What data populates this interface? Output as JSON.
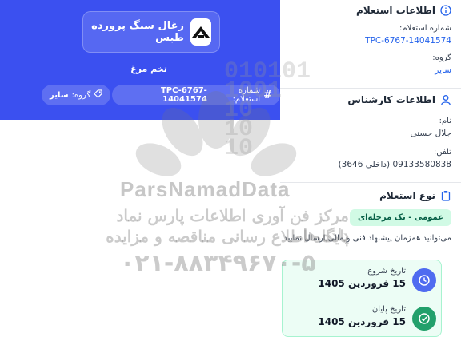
{
  "header": {
    "company_name": "زغال سنگ پرورده طبس",
    "subject": "تخم مرغ",
    "inquiry_number_label": "شماره استعلام:",
    "inquiry_number": "TPC-6767-14041574",
    "group_label": "گروه:",
    "group_value": "سایر"
  },
  "inquiry_info": {
    "title": "اطلاعات استعلام",
    "number_label": "شماره استعلام:",
    "number_value": "TPC-6767-14041574",
    "group_label": "گروه:",
    "group_value": "سایر"
  },
  "expert_info": {
    "title": "اطلاعات کارشناس",
    "name_label": "نام:",
    "name_value": "جلال حسنی",
    "phone_label": "تلفن:",
    "phone_value": "09133580838 (داخلی 3646)"
  },
  "inquiry_type": {
    "title": "نوع استعلام",
    "badge": "عمومی - تک مرحله‌ای",
    "description": "می‌توانید همزمان پیشنهاد فنی و مالی ارسال نمایید"
  },
  "dates": {
    "start_label": "تاریخ شروع",
    "start_value": "15 فروردین 1405",
    "end_label": "تاریخ پایان",
    "end_value": "15 فروردین 1405"
  },
  "watermark": {
    "digits": "010101\n1001\n10\n10\n10",
    "brand": "ParsNamadData",
    "line1": "مرکز فن آوری اطلاعات پارس نماد داده ها",
    "line2": "پایگاه اطلاع رسانی مناقصه و مزایده",
    "phone": "۰۲۱-۸۸۳۴۹۶۷۰-۵"
  },
  "colors": {
    "hero_blue": "#3b50f0",
    "link_blue": "#2563eb",
    "green_bg": "#ecfdf5",
    "clock_circle": "#4f6bf0",
    "check_circle": "#22a06b"
  }
}
